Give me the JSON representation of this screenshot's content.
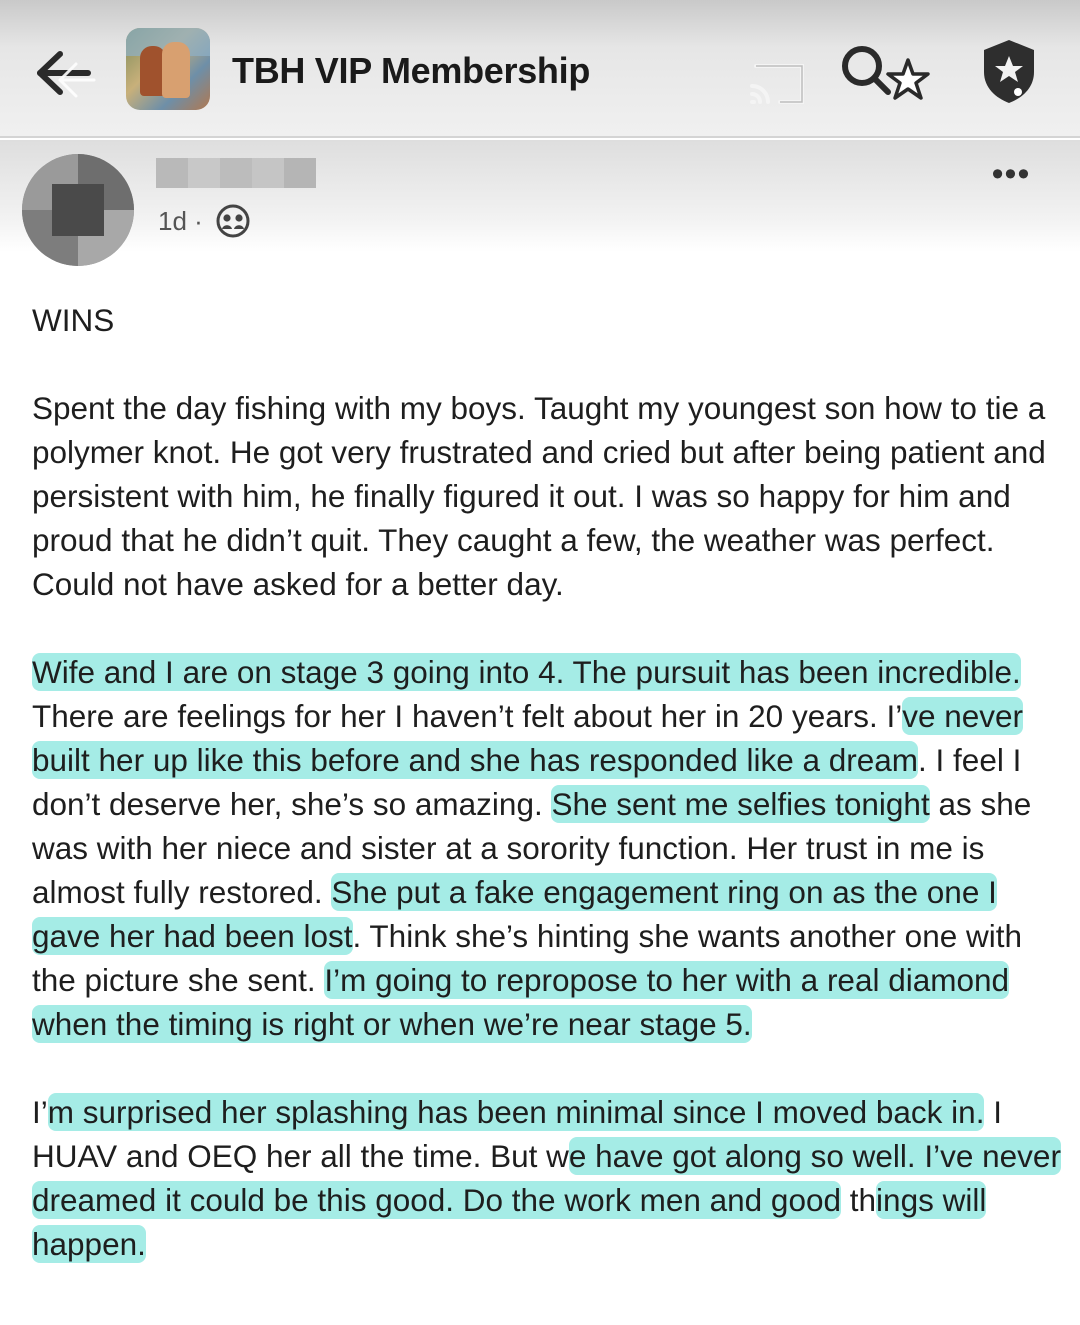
{
  "header": {
    "title": "TBH VIP Membership",
    "icons": {
      "back": "back-arrow-icon",
      "group_avatar": "group-avatar-photo",
      "cast": "cast-icon",
      "search_star": "search-star-icon",
      "shield": "shield-icon"
    }
  },
  "post": {
    "author_name": "",
    "time": "1d",
    "separator": "·",
    "privacy_icon": "group-members-icon",
    "more_label": "•••",
    "title": "WINS",
    "paragraphs": [
      {
        "segments": [
          {
            "text": "Spent the day fishing with my boys. Taught my youngest son how to tie a polymer knot. He got very frustrated and cried but after being patient and persistent with him, he finally figured it out. I was so happy for him and proud that he didn’t quit. They caught a few, the weather was perfect. Could not have asked for a better day.",
            "highlight": false
          }
        ]
      },
      {
        "segments": [
          {
            "text": "Wife and I are on stage 3 going into 4. The pursuit has been incredible.",
            "highlight": true
          },
          {
            "text": " There are feelings for her I haven’t felt about her in 20 years. I’",
            "highlight": false
          },
          {
            "text": "ve never built her up like this before and she has responded like a dream",
            "highlight": true
          },
          {
            "text": ". I feel I don’t deserve her, she’s so amazing. ",
            "highlight": false
          },
          {
            "text": "She sent me selfies tonight",
            "highlight": true
          },
          {
            "text": " as she was with her niece and sister at a sorority function. Her trust in me is almost fully restored. ",
            "highlight": false
          },
          {
            "text": "She put a fake engagement ring on as the one I gave her had been lost",
            "highlight": true
          },
          {
            "text": ". Think she’s hinting she wants another one with the picture she sent. ",
            "highlight": false
          },
          {
            "text": "I’m going to repropose to her with a real diamond when the timing is right or when we’re near stage 5.",
            "highlight": true
          }
        ]
      },
      {
        "segments": [
          {
            "text": "I’",
            "highlight": false
          },
          {
            "text": "m surprised her splashing has been minimal since I moved back in.",
            "highlight": true
          },
          {
            "text": " I HUAV and OEQ her all the time. But w",
            "highlight": false
          },
          {
            "text": "e have got along so well. I’ve never dreamed it could be this good. Do the work men and good",
            "highlight": true
          },
          {
            "text": " th",
            "highlight": false
          },
          {
            "text": "ings will happen.",
            "highlight": true
          }
        ]
      }
    ]
  },
  "colors": {
    "highlight": "#6ee0d6",
    "header_bg": "#e6e6e6",
    "text": "#1e1e1e"
  }
}
